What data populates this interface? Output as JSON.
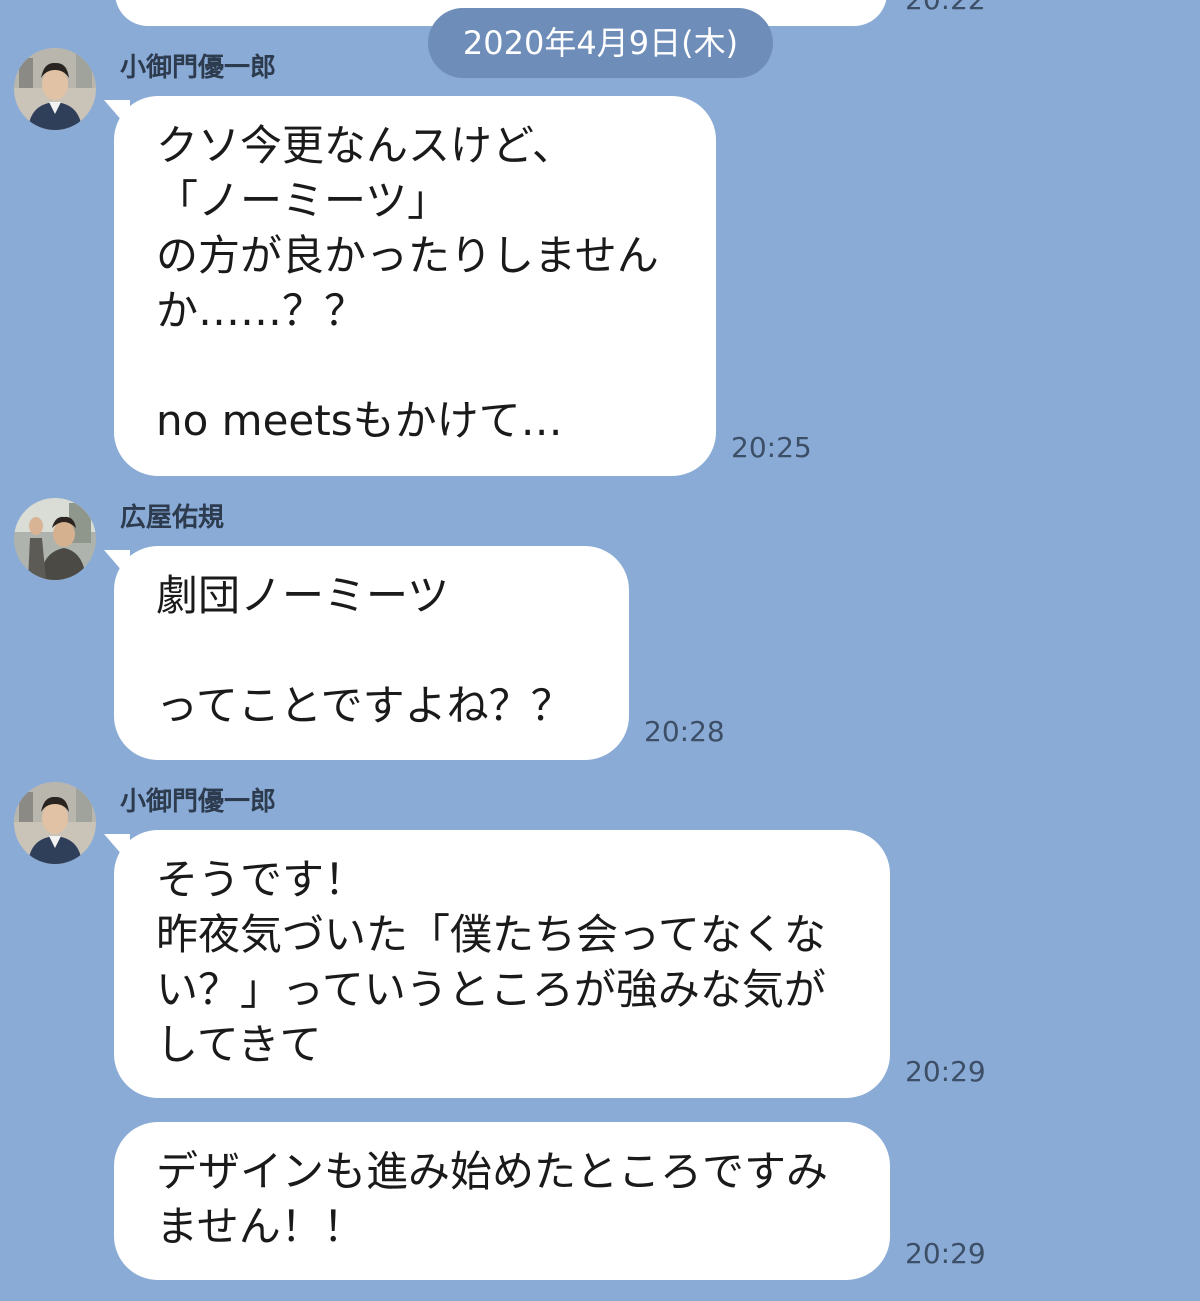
{
  "date_divider": "2020年4月9日(木)",
  "previous_time": "20:22",
  "messages": [
    {
      "sender": "小御門優一郎",
      "text": "クソ今更なんスけど、\n「ノーミーツ」\nの方が良かったりしません\nか……？？\n\nno meetsもかけて…",
      "time": "20:25"
    },
    {
      "sender": "広屋佑規",
      "text": "劇団ノーミーツ\n\nってことですよね？？",
      "time": "20:28"
    },
    {
      "sender": "小御門優一郎",
      "text": "そうです！\n昨夜気づいた「僕たち会ってなくな\nい？」っていうところが強みな気が\nしてきて",
      "time": "20:29"
    },
    {
      "sender": "",
      "text": "デザインも進み始めたところですみ\nません！！",
      "time": "20:29"
    }
  ],
  "avatars": {
    "a1": "person-avatar-icon",
    "a2": "person-avatar-icon"
  }
}
